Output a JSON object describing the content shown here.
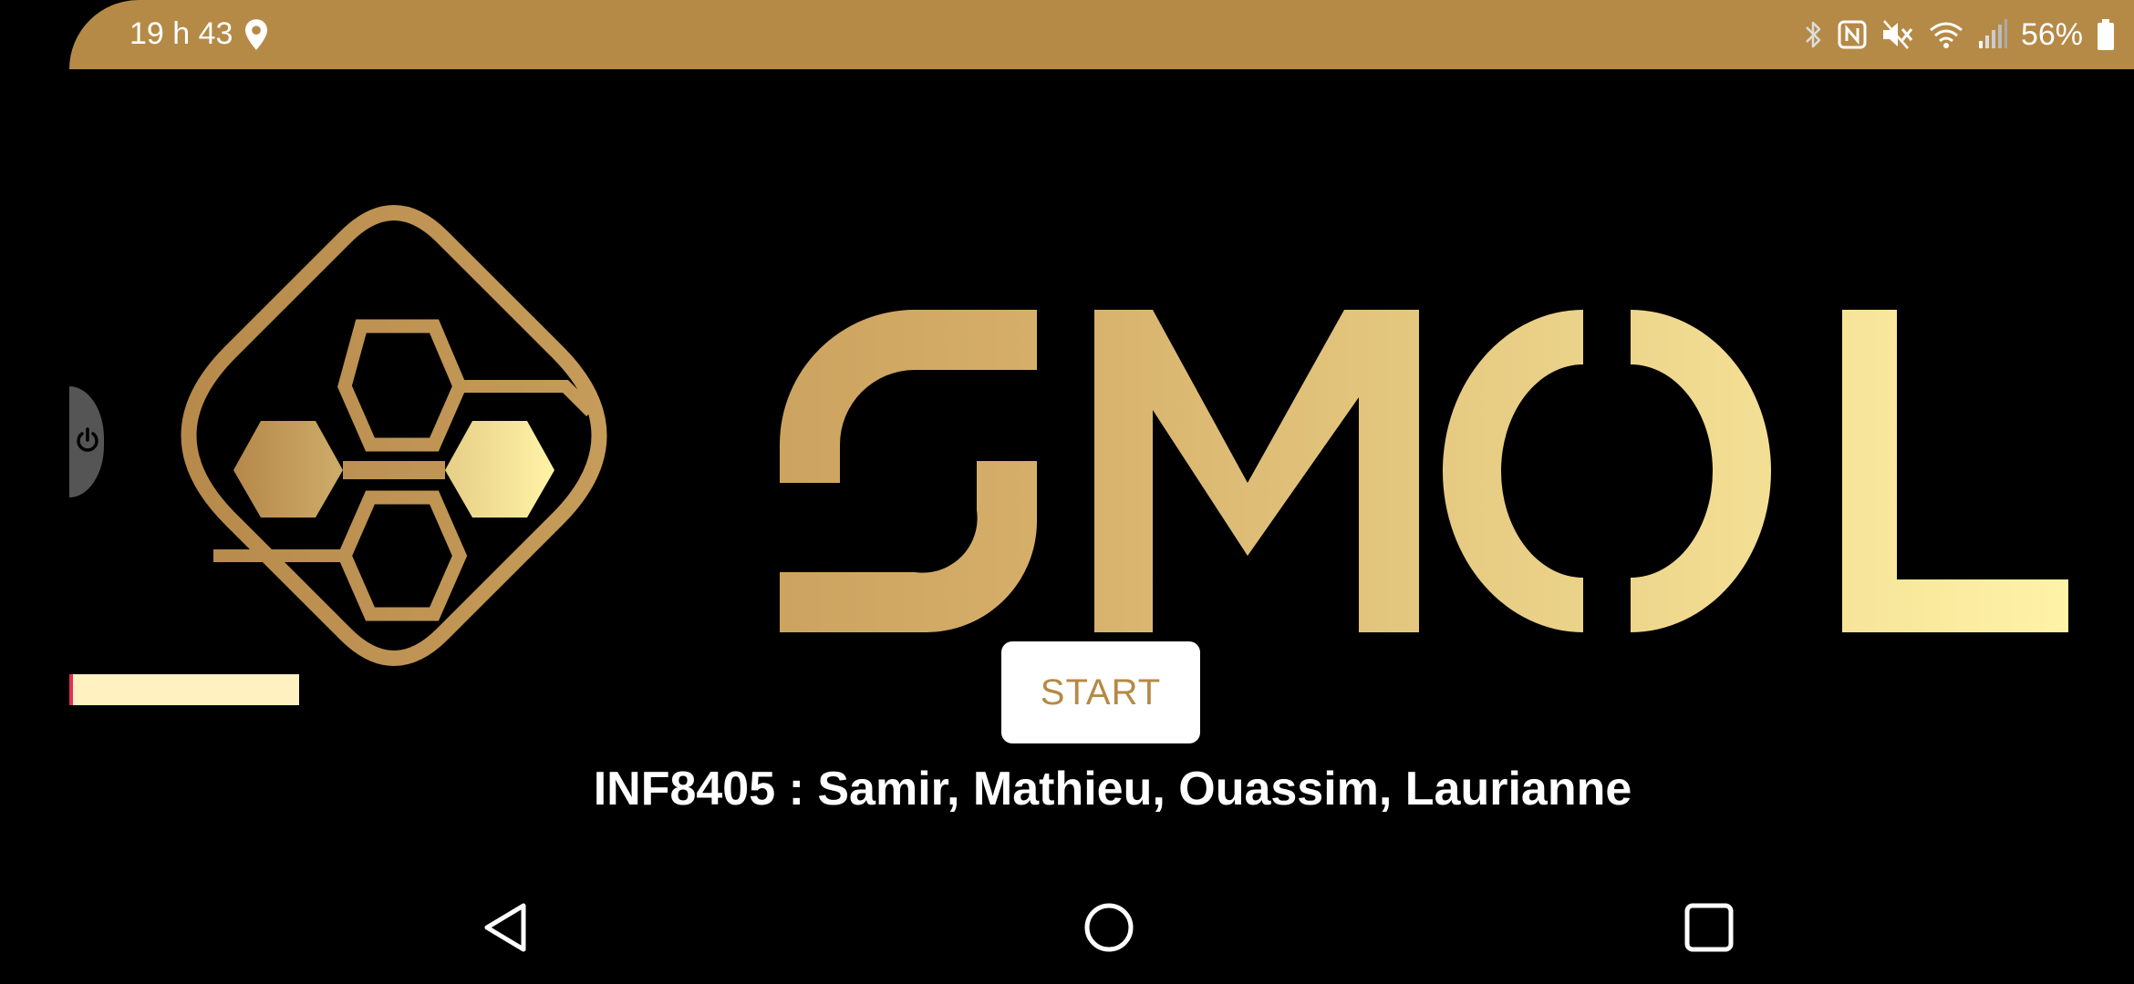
{
  "status_bar": {
    "time": "19 h 43",
    "battery": "56%",
    "icons": [
      "location-icon",
      "bluetooth-icon",
      "nfc-icon",
      "mute-icon",
      "wifi-icon",
      "signal-icon",
      "battery-icon"
    ],
    "background_color": "#b58a46"
  },
  "logo": {
    "text": "SMOL",
    "gradient_colors": [
      "#b5884a",
      "#fff3a6"
    ]
  },
  "loading": {
    "progress": 0.01,
    "track_color": "#fff2c0",
    "fill_color": "#e0305a"
  },
  "start_button": {
    "label": "START",
    "text_color": "#b58a46"
  },
  "credits": "INF8405 : Samir, Mathieu, Ouassim, Laurianne",
  "side_handle": {
    "icon": "power-icon"
  },
  "nav_bar": {
    "buttons": [
      "back-icon",
      "home-icon",
      "recents-icon"
    ]
  }
}
